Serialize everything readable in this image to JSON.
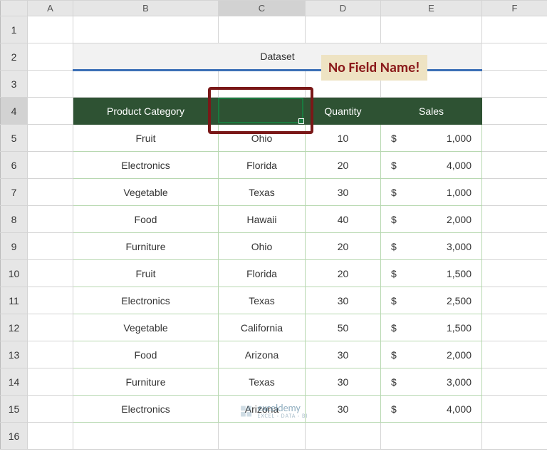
{
  "cols": [
    "A",
    "B",
    "C",
    "D",
    "E",
    "F"
  ],
  "rowCount": 16,
  "selectedCol": "C",
  "selectedRow": 4,
  "title": "Dataset",
  "callout": "No Field Name!",
  "headers": {
    "b": "Product Category",
    "c": "",
    "d": "Quantity",
    "e": "Sales"
  },
  "rows": [
    {
      "b": "Fruit",
      "c": "Ohio",
      "d": "10",
      "cur": "$",
      "amt": "1,000"
    },
    {
      "b": "Electronics",
      "c": "Florida",
      "d": "20",
      "cur": "$",
      "amt": "4,000"
    },
    {
      "b": "Vegetable",
      "c": "Texas",
      "d": "30",
      "cur": "$",
      "amt": "1,000"
    },
    {
      "b": "Food",
      "c": "Hawaii",
      "d": "40",
      "cur": "$",
      "amt": "2,000"
    },
    {
      "b": "Furniture",
      "c": "Ohio",
      "d": "20",
      "cur": "$",
      "amt": "3,000"
    },
    {
      "b": "Fruit",
      "c": "Florida",
      "d": "20",
      "cur": "$",
      "amt": "1,500"
    },
    {
      "b": "Electronics",
      "c": "Texas",
      "d": "30",
      "cur": "$",
      "amt": "2,500"
    },
    {
      "b": "Vegetable",
      "c": "California",
      "d": "50",
      "cur": "$",
      "amt": "1,500"
    },
    {
      "b": "Food",
      "c": "Arizona",
      "d": "30",
      "cur": "$",
      "amt": "2,000"
    },
    {
      "b": "Furniture",
      "c": "Texas",
      "d": "30",
      "cur": "$",
      "amt": "3,000"
    },
    {
      "b": "Electronics",
      "c": "Arizona",
      "d": "30",
      "cur": "$",
      "amt": "4,000"
    }
  ],
  "watermark": {
    "main": "exceldemy",
    "sub": "EXCEL · DATA · BI"
  }
}
